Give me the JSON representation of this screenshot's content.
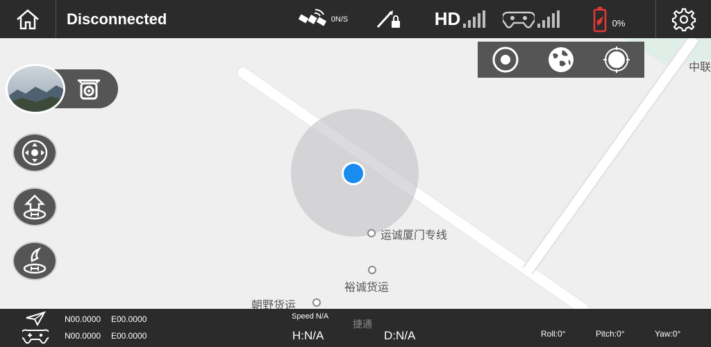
{
  "topbar": {
    "status": "Disconnected",
    "satellite_text": "0N/S",
    "video_label": "HD",
    "battery_text": "0%",
    "icons": [
      "home-icon",
      "satellite-icon",
      "lock-icon",
      "signal-bars-icon",
      "controller-icon",
      "battery-icon",
      "gear-icon"
    ]
  },
  "map": {
    "pois": [
      {
        "label": "运诚厦门专线"
      },
      {
        "label": "裕诚货运"
      },
      {
        "label": "朝野货运"
      },
      {
        "label": "捷通"
      },
      {
        "label": "中联"
      }
    ]
  },
  "map_modes": [
    "map-locate-icon",
    "globe-icon",
    "crosshair-icon"
  ],
  "left_controls": [
    "camera-preview",
    "camera-mode-icon",
    "joystick-dpad-icon",
    "home-landing-icon",
    "takeoff-icon"
  ],
  "bottombar": {
    "lat_1": "N00.0000",
    "lon_1": "E00.0000",
    "lat_2": "N00.0000",
    "lon_2": "E00.0000",
    "speed_label": "Speed N/A",
    "height": "H:N/A",
    "distance": "D:N/A",
    "roll": "Roll:0°",
    "pitch": "Pitch:0°",
    "yaw": "Yaw:0°"
  },
  "colors": {
    "bar_bg": "#2b2b2b",
    "map_bg": "#efefef",
    "location_dot": "#1a8cf0",
    "battery_red": "#e53935"
  }
}
